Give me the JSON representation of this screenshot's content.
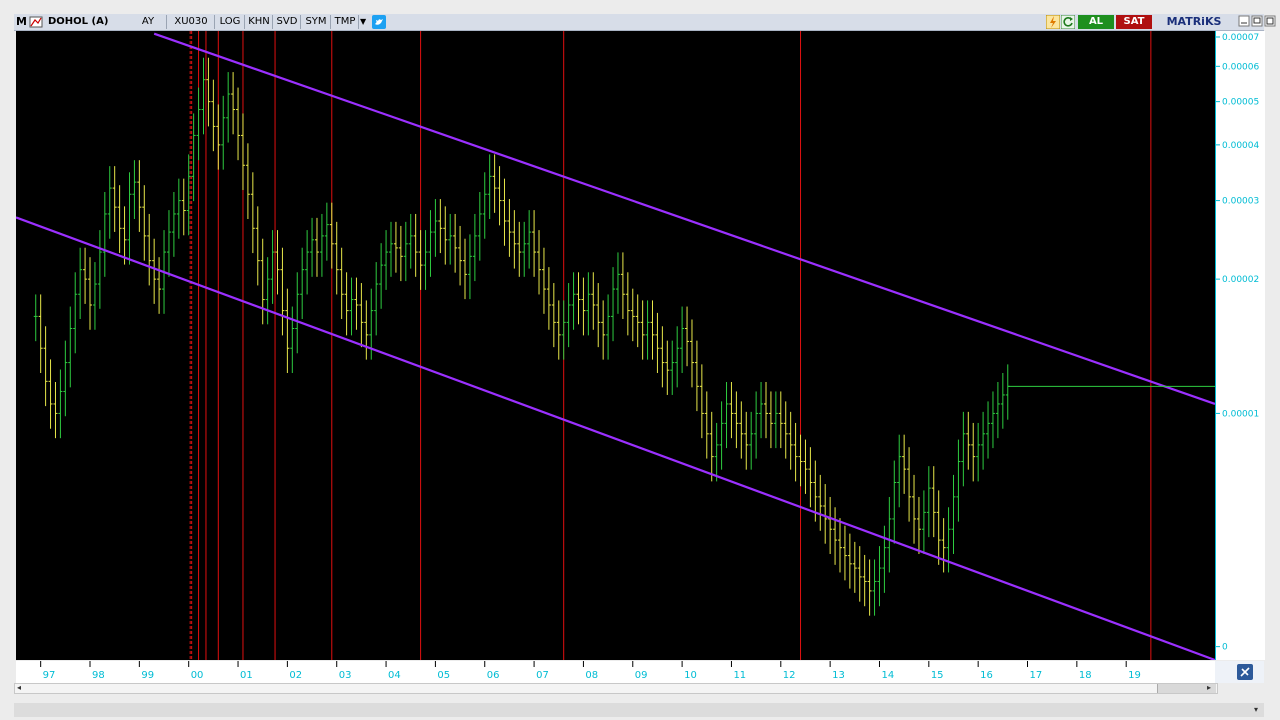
{
  "toolbar": {
    "logo": "M",
    "symbol": "DOHOL (A)",
    "period": "AY",
    "index": "XU030",
    "buttons": [
      "LOG",
      "KHN",
      "SVD",
      "SYM",
      "TMP"
    ],
    "buy_label": "AL",
    "sell_label": "SAT",
    "brand": "MATRiKS"
  },
  "colors": {
    "background": "#000000",
    "candle_up": "#2ecc40",
    "candle_down": "#e8e84a",
    "trendline": "#9b30ff",
    "vertical_marker": "#e01010",
    "axis_text": "#00bcd4",
    "buy": "#1e8f1e",
    "sell": "#b01010"
  },
  "chart_data": {
    "type": "ohlc",
    "scale": "log",
    "x_tick_labels": [
      "97",
      "98",
      "99",
      "00",
      "01",
      "02",
      "03",
      "04",
      "05",
      "06",
      "07",
      "08",
      "09",
      "10",
      "11",
      "12",
      "13",
      "14",
      "15",
      "16",
      "17",
      "18",
      "19"
    ],
    "y_tick_labels": [
      "0.00007",
      "0.00006",
      "0.00005",
      "0.00004",
      "0.00003",
      "0.00002",
      "0.00001",
      "0"
    ],
    "y_ticks": [
      7e-05,
      6e-05,
      5e-05,
      4e-05,
      3e-05,
      2e-05,
      1e-05,
      3e-06
    ],
    "ylim": [
      2.8e-06,
      7.2e-05
    ],
    "xlim": [
      1996.5,
      2020.8
    ],
    "close": [
      [
        1996.9,
        1.65e-05
      ],
      [
        1997.0,
        1.4e-05
      ],
      [
        1997.1,
        1.18e-05
      ],
      [
        1997.2,
        1.05e-05
      ],
      [
        1997.3,
        1e-05
      ],
      [
        1997.4,
        1.12e-05
      ],
      [
        1997.5,
        1.3e-05
      ],
      [
        1997.6,
        1.55e-05
      ],
      [
        1997.7,
        1.85e-05
      ],
      [
        1997.8,
        2.1e-05
      ],
      [
        1997.9,
        2e-05
      ],
      [
        1998.0,
        1.75e-05
      ],
      [
        1998.1,
        1.95e-05
      ],
      [
        1998.2,
        2.3e-05
      ],
      [
        1998.3,
        2.8e-05
      ],
      [
        1998.4,
        3.2e-05
      ],
      [
        1998.5,
        2.9e-05
      ],
      [
        1998.6,
        2.6e-05
      ],
      [
        1998.7,
        2.45e-05
      ],
      [
        1998.8,
        3.1e-05
      ],
      [
        1998.9,
        3.3e-05
      ],
      [
        1999.0,
        2.9e-05
      ],
      [
        1999.1,
        2.5e-05
      ],
      [
        1999.2,
        2.2e-05
      ],
      [
        1999.3,
        2e-05
      ],
      [
        1999.4,
        1.9e-05
      ],
      [
        1999.5,
        2.3e-05
      ],
      [
        1999.6,
        2.55e-05
      ],
      [
        1999.7,
        2.8e-05
      ],
      [
        1999.8,
        3e-05
      ],
      [
        1999.9,
        2.85e-05
      ],
      [
        2000.0,
        3.4e-05
      ],
      [
        2000.1,
        4.2e-05
      ],
      [
        2000.2,
        4.8e-05
      ],
      [
        2000.3,
        5.6e-05
      ],
      [
        2000.4,
        5e-05
      ],
      [
        2000.5,
        4.4e-05
      ],
      [
        2000.6,
        4e-05
      ],
      [
        2000.7,
        4.6e-05
      ],
      [
        2000.8,
        5.2e-05
      ],
      [
        2000.9,
        4.8e-05
      ],
      [
        2001.0,
        4.2e-05
      ],
      [
        2001.1,
        3.6e-05
      ],
      [
        2001.2,
        3.1e-05
      ],
      [
        2001.3,
        2.6e-05
      ],
      [
        2001.4,
        2.2e-05
      ],
      [
        2001.5,
        1.8e-05
      ],
      [
        2001.6,
        2e-05
      ],
      [
        2001.7,
        2.3e-05
      ],
      [
        2001.8,
        2.1e-05
      ],
      [
        2001.9,
        1.7e-05
      ],
      [
        2002.0,
        1.4e-05
      ],
      [
        2002.1,
        1.55e-05
      ],
      [
        2002.2,
        1.85e-05
      ],
      [
        2002.3,
        2.1e-05
      ],
      [
        2002.4,
        2.3e-05
      ],
      [
        2002.5,
        2.45e-05
      ],
      [
        2002.6,
        2.3e-05
      ],
      [
        2002.7,
        2.5e-05
      ],
      [
        2002.8,
        2.65e-05
      ],
      [
        2002.9,
        2.4e-05
      ],
      [
        2003.0,
        2.1e-05
      ],
      [
        2003.1,
        1.85e-05
      ],
      [
        2003.2,
        1.7e-05
      ],
      [
        2003.3,
        1.8e-05
      ],
      [
        2003.4,
        1.75e-05
      ],
      [
        2003.5,
        1.6e-05
      ],
      [
        2003.6,
        1.5e-05
      ],
      [
        2003.7,
        1.7e-05
      ],
      [
        2003.8,
        1.95e-05
      ],
      [
        2003.9,
        2.15e-05
      ],
      [
        2004.0,
        2.3e-05
      ],
      [
        2004.1,
        2.4e-05
      ],
      [
        2004.2,
        2.35e-05
      ],
      [
        2004.3,
        2.25e-05
      ],
      [
        2004.4,
        2.4e-05
      ],
      [
        2004.5,
        2.5e-05
      ],
      [
        2004.6,
        2.3e-05
      ],
      [
        2004.7,
        2.15e-05
      ],
      [
        2004.8,
        2.3e-05
      ],
      [
        2004.9,
        2.55e-05
      ],
      [
        2005.0,
        2.7e-05
      ],
      [
        2005.1,
        2.6e-05
      ],
      [
        2005.2,
        2.45e-05
      ],
      [
        2005.3,
        2.5e-05
      ],
      [
        2005.4,
        2.35e-05
      ],
      [
        2005.5,
        2.2e-05
      ],
      [
        2005.6,
        2.05e-05
      ],
      [
        2005.7,
        2.25e-05
      ],
      [
        2005.8,
        2.5e-05
      ],
      [
        2005.9,
        2.8e-05
      ],
      [
        2006.0,
        3.1e-05
      ],
      [
        2006.1,
        3.4e-05
      ],
      [
        2006.2,
        3.2e-05
      ],
      [
        2006.3,
        3e-05
      ],
      [
        2006.4,
        2.7e-05
      ],
      [
        2006.5,
        2.55e-05
      ],
      [
        2006.6,
        2.4e-05
      ],
      [
        2006.7,
        2.3e-05
      ],
      [
        2006.8,
        2.4e-05
      ],
      [
        2006.9,
        2.55e-05
      ],
      [
        2007.0,
        2.3e-05
      ],
      [
        2007.1,
        2.1e-05
      ],
      [
        2007.2,
        1.9e-05
      ],
      [
        2007.3,
        1.75e-05
      ],
      [
        2007.4,
        1.6e-05
      ],
      [
        2007.5,
        1.5e-05
      ],
      [
        2007.6,
        1.6e-05
      ],
      [
        2007.7,
        1.75e-05
      ],
      [
        2007.8,
        1.85e-05
      ],
      [
        2007.9,
        1.8e-05
      ],
      [
        2008.0,
        1.7e-05
      ],
      [
        2008.1,
        1.85e-05
      ],
      [
        2008.2,
        1.75e-05
      ],
      [
        2008.3,
        1.6e-05
      ],
      [
        2008.4,
        1.5e-05
      ],
      [
        2008.5,
        1.65e-05
      ],
      [
        2008.6,
        1.9e-05
      ],
      [
        2008.7,
        2.05e-05
      ],
      [
        2008.8,
        1.85e-05
      ],
      [
        2008.9,
        1.7e-05
      ],
      [
        2009.0,
        1.65e-05
      ],
      [
        2009.1,
        1.6e-05
      ],
      [
        2009.2,
        1.5e-05
      ],
      [
        2009.3,
        1.6e-05
      ],
      [
        2009.4,
        1.5e-05
      ],
      [
        2009.5,
        1.4e-05
      ],
      [
        2009.6,
        1.3e-05
      ],
      [
        2009.7,
        1.25e-05
      ],
      [
        2009.8,
        1.3e-05
      ],
      [
        2009.9,
        1.4e-05
      ],
      [
        2010.0,
        1.55e-05
      ],
      [
        2010.1,
        1.45e-05
      ],
      [
        2010.2,
        1.3e-05
      ],
      [
        2010.3,
        1.15e-05
      ],
      [
        2010.4,
        1e-05
      ],
      [
        2010.5,
        9e-06
      ],
      [
        2010.6,
        8e-06
      ],
      [
        2010.7,
        8.5e-06
      ],
      [
        2010.8,
        9.5e-06
      ],
      [
        2010.9,
        1.05e-05
      ],
      [
        2011.0,
        1e-05
      ],
      [
        2011.1,
        9.5e-06
      ],
      [
        2011.2,
        9e-06
      ],
      [
        2011.3,
        8.5e-06
      ],
      [
        2011.4,
        9e-06
      ],
      [
        2011.5,
        1e-05
      ],
      [
        2011.6,
        1.05e-05
      ],
      [
        2011.7,
        1e-05
      ],
      [
        2011.8,
        9.5e-06
      ],
      [
        2011.9,
        1e-05
      ],
      [
        2012.0,
        9.5e-06
      ],
      [
        2012.1,
        9e-06
      ],
      [
        2012.2,
        8.5e-06
      ],
      [
        2012.3,
        8e-06
      ],
      [
        2012.4,
        7.8e-06
      ],
      [
        2012.5,
        7.5e-06
      ],
      [
        2012.6,
        7e-06
      ],
      [
        2012.7,
        6.5e-06
      ],
      [
        2012.8,
        6.2e-06
      ],
      [
        2012.9,
        5.8e-06
      ],
      [
        2013.0,
        5.5e-06
      ],
      [
        2013.1,
        5.2e-06
      ],
      [
        2013.2,
        5e-06
      ],
      [
        2013.3,
        4.8e-06
      ],
      [
        2013.4,
        4.6e-06
      ],
      [
        2013.5,
        4.5e-06
      ],
      [
        2013.6,
        4.3e-06
      ],
      [
        2013.7,
        4.2e-06
      ],
      [
        2013.8,
        4e-06
      ],
      [
        2013.9,
        4.2e-06
      ],
      [
        2014.0,
        4.5e-06
      ],
      [
        2014.1,
        5e-06
      ],
      [
        2014.2,
        5.8e-06
      ],
      [
        2014.3,
        7e-06
      ],
      [
        2014.4,
        8e-06
      ],
      [
        2014.5,
        7.5e-06
      ],
      [
        2014.6,
        6.5e-06
      ],
      [
        2014.7,
        5.8e-06
      ],
      [
        2014.8,
        5.5e-06
      ],
      [
        2014.9,
        6e-06
      ],
      [
        2015.0,
        6.8e-06
      ],
      [
        2015.1,
        6e-06
      ],
      [
        2015.2,
        5.2e-06
      ],
      [
        2015.3,
        5e-06
      ],
      [
        2015.4,
        5.5e-06
      ],
      [
        2015.5,
        6.5e-06
      ],
      [
        2015.6,
        7.8e-06
      ],
      [
        2015.7,
        9e-06
      ],
      [
        2015.8,
        8.5e-06
      ],
      [
        2015.9,
        8e-06
      ],
      [
        2016.0,
        8.5e-06
      ],
      [
        2016.1,
        9e-06
      ],
      [
        2016.2,
        9.5e-06
      ],
      [
        2016.3,
        1e-05
      ],
      [
        2016.4,
        1.05e-05
      ],
      [
        2016.5,
        1.1e-05
      ],
      [
        2016.6,
        1.15e-05
      ]
    ]
  }
}
